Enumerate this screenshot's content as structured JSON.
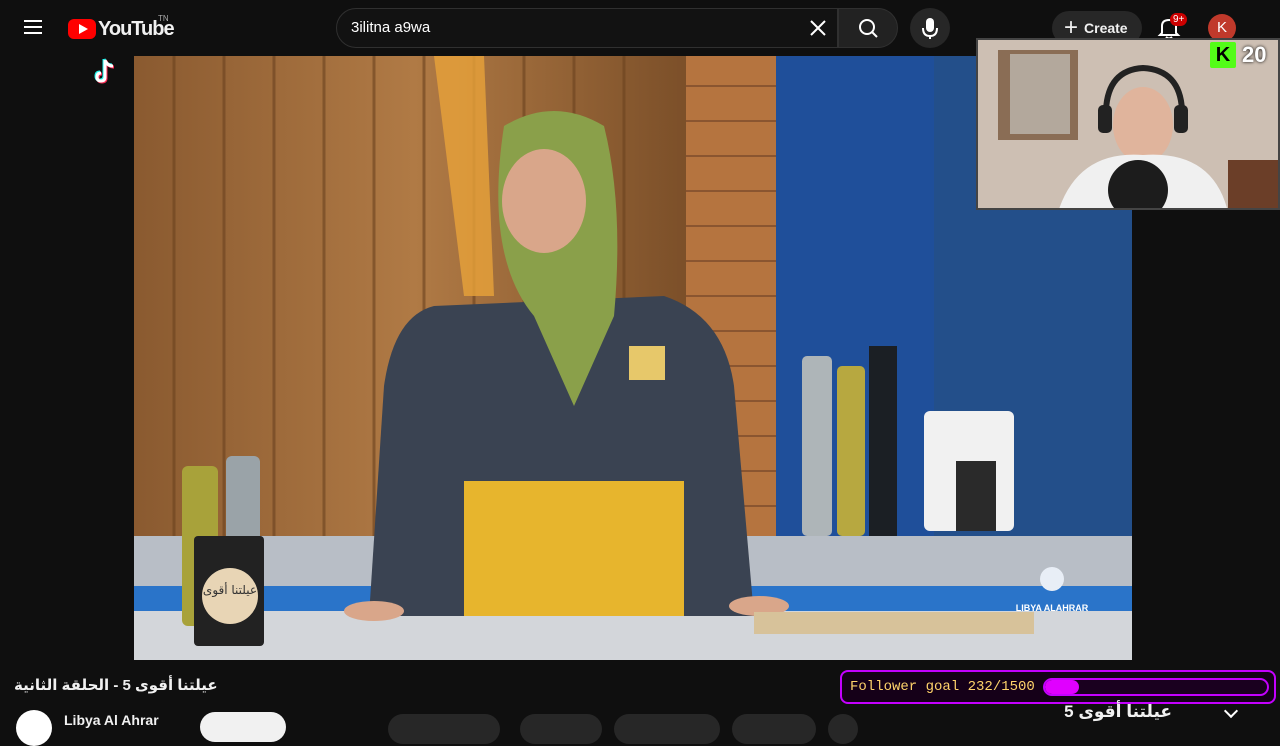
{
  "header": {
    "logo_text": "YouTube",
    "logo_region": "TN",
    "search_value": "3ilitna a9wa",
    "create_label": "Create",
    "notification_count": "9+",
    "avatar_initial": "K"
  },
  "video": {
    "watermark_logo_text": "عيلتنا أقوى",
    "channel_bug_text": "LIBYA ALAHRAR"
  },
  "overlay": {
    "kick_viewers": "20",
    "follower_goal_label": "Follower goal 232/1500",
    "follower_goal_progress": 0.155
  },
  "below_video": {
    "video_title": "عيلتنا أقوى 5 - الحلقة الثانية",
    "channel_name": "Libya Al Ahrar",
    "playlist_title": "عيلتنا أقوى 5"
  },
  "colors": {
    "youtube_red": "#ff0000",
    "kick_green": "#53fc18",
    "goal_purple": "#c400ff",
    "goal_text": "#ffd36b"
  },
  "icons": [
    "menu-icon",
    "youtube-logo-icon",
    "clear-icon",
    "search-icon",
    "mic-icon",
    "plus-icon",
    "bell-icon",
    "tiktok-icon",
    "kick-icon",
    "chevron-down-icon"
  ]
}
